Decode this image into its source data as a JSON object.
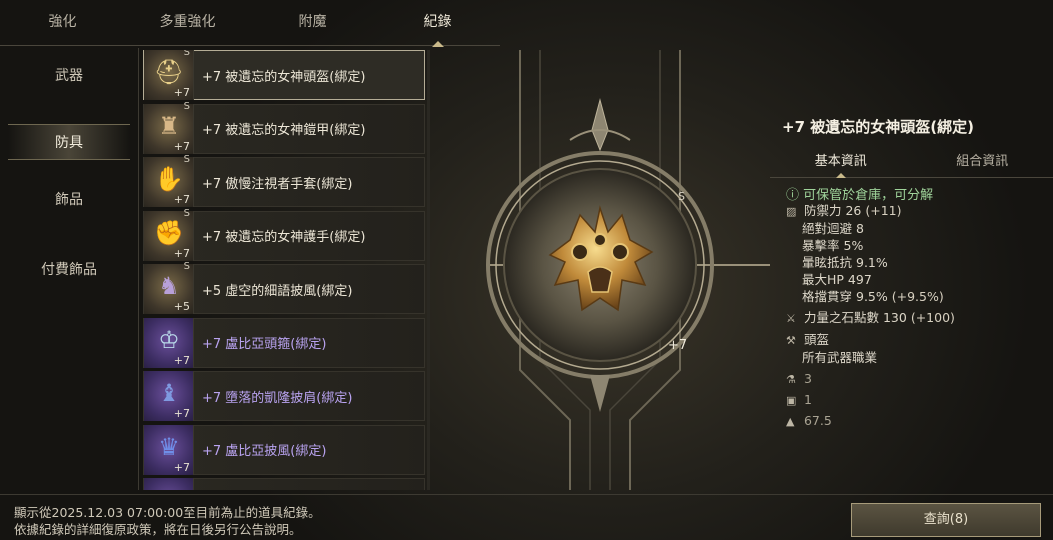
{
  "tabs": [
    "強化",
    "多重強化",
    "附魔",
    "紀錄"
  ],
  "categories": [
    "武器",
    "防具",
    "飾品",
    "付費飾品"
  ],
  "items": [
    {
      "name": "+7 被遺忘的女神頭盔(綁定)",
      "level": "+7",
      "grade": "S",
      "rarity": "gold",
      "icon": "helmet-icon"
    },
    {
      "name": "+7 被遺忘的女神鎧甲(綁定)",
      "level": "+7",
      "grade": "S",
      "rarity": "gold",
      "icon": "armor-icon"
    },
    {
      "name": "+7 傲慢注視者手套(綁定)",
      "level": "+7",
      "grade": "S",
      "rarity": "gold",
      "icon": "glove-icon"
    },
    {
      "name": "+7 被遺忘的女神護手(綁定)",
      "level": "+7",
      "grade": "S",
      "rarity": "gold",
      "icon": "gauntlet-icon"
    },
    {
      "name": "+5 虛空的細語披風(綁定)",
      "level": "+5",
      "grade": "S",
      "rarity": "gold",
      "icon": "cloak-icon"
    },
    {
      "name": "+7 盧比亞頭箍(綁定)",
      "level": "+7",
      "grade": "",
      "rarity": "purple",
      "icon": "circlet-icon"
    },
    {
      "name": "+7 墮落的凱隆披肩(綁定)",
      "level": "+7",
      "grade": "",
      "rarity": "purple",
      "icon": "mantle-icon"
    },
    {
      "name": "+7 盧比亞披風(綁定)",
      "level": "+7",
      "grade": "",
      "rarity": "purple",
      "icon": "cape-icon"
    }
  ],
  "emblem": {
    "level": "+7",
    "grade": "S"
  },
  "detail": {
    "title": "+7 被遺忘的女神頭盔(綁定)",
    "tabs": [
      "基本資訊",
      "組合資訊"
    ],
    "note": "可保管於倉庫，可分解",
    "stats": [
      {
        "label": "防禦力",
        "value": "26",
        "bonus": "(+11)"
      },
      {
        "label": "絕對迴避",
        "value": "8",
        "bonus": ""
      },
      {
        "label": "暴擊率",
        "value": "5%",
        "bonus": ""
      },
      {
        "label": "暈眩抵抗",
        "value": "9.1%",
        "bonus": ""
      },
      {
        "label": "最大HP",
        "value": "497",
        "bonus": ""
      },
      {
        "label": "格擋貫穿",
        "value": "9.5%",
        "bonus": "(+9.5%)"
      }
    ],
    "power_stone": {
      "label": "力量之石點數",
      "value": "130",
      "bonus": "(+100)"
    },
    "slot": "頭盔",
    "job": "所有武器職業",
    "misc": [
      "3",
      "1",
      "67.5"
    ]
  },
  "footer": {
    "line1": "顯示從2025.12.03 07:00:00至目前為止的道具紀錄。",
    "line2": "依據紀錄的詳細復原政策，將在日後另行公告說明。"
  },
  "query_label": "查詢(8)"
}
